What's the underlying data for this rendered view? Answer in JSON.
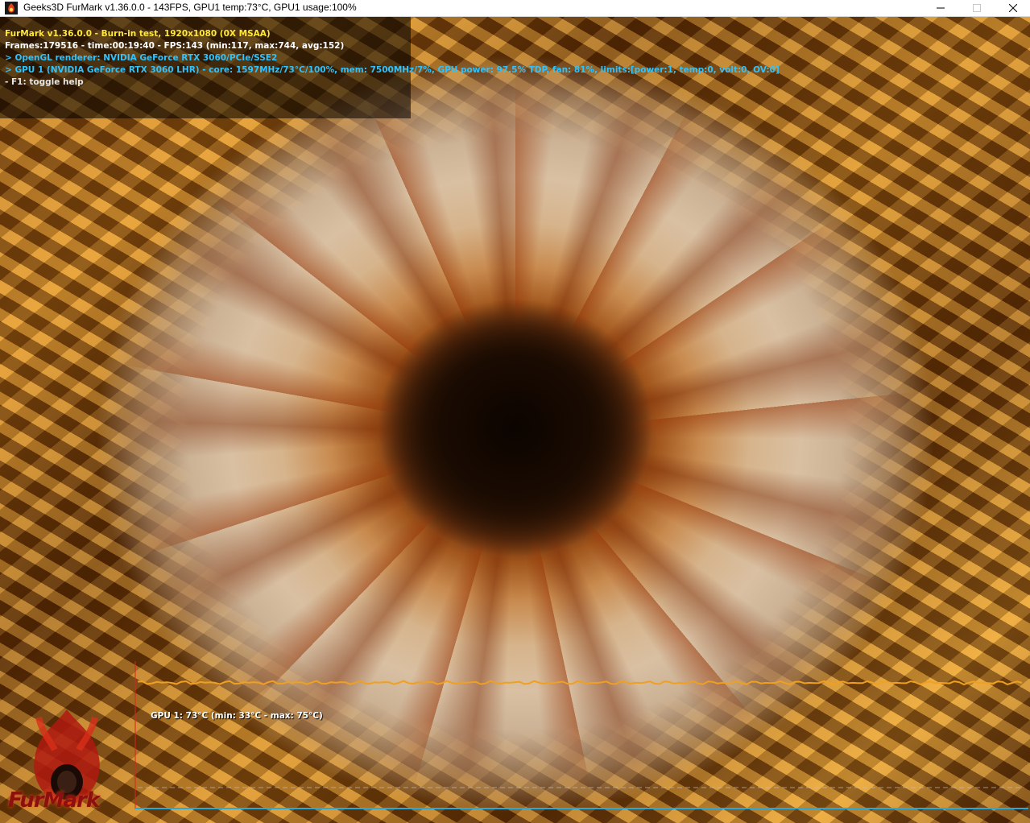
{
  "window": {
    "title": "Geeks3D FurMark v1.36.0.0 - 143FPS, GPU1 temp:73°C, GPU1 usage:100%",
    "icon": "furmark-app-icon",
    "controls": [
      "minimize-icon",
      "maximize-icon",
      "close-icon"
    ]
  },
  "hud": {
    "line1": "FurMark v1.36.0.0 - Burn-in test, 1920x1080 (0X MSAA)",
    "line2": "Frames:179516 - time:00:19:40 - FPS:143 (min:117, max:744, avg:152)",
    "line3": "> OpenGL renderer: NVIDIA GeForce RTX 3060/PCIe/SSE2",
    "line4": "> GPU 1 (NVIDIA GeForce RTX 3060 LHR) - core: 1597MHz/73°C/100%, mem: 7500MHz/7%, GPU power: 97.5% TDP, fan: 81%, limits:[power:1, temp:0, volt:0, OV:0]",
    "line5": "- F1: toggle help"
  },
  "logo": {
    "text": "FurMark",
    "icon": "furmark-flame-logo"
  },
  "graph": {
    "label": "GPU 1: 73°C (min: 33°C - max: 75°C)",
    "current_temp_c": 73,
    "min_temp_c": 33,
    "max_temp_c": 75,
    "colors": {
      "line": "#f0a020",
      "axis": "#2aa8d8",
      "marker": "#e02020",
      "baseline": "#bfbfbf"
    }
  },
  "colors": {
    "hud_title": "#ffe933",
    "hud_info": "#2ec3ff",
    "hud_text": "#ffffff"
  }
}
